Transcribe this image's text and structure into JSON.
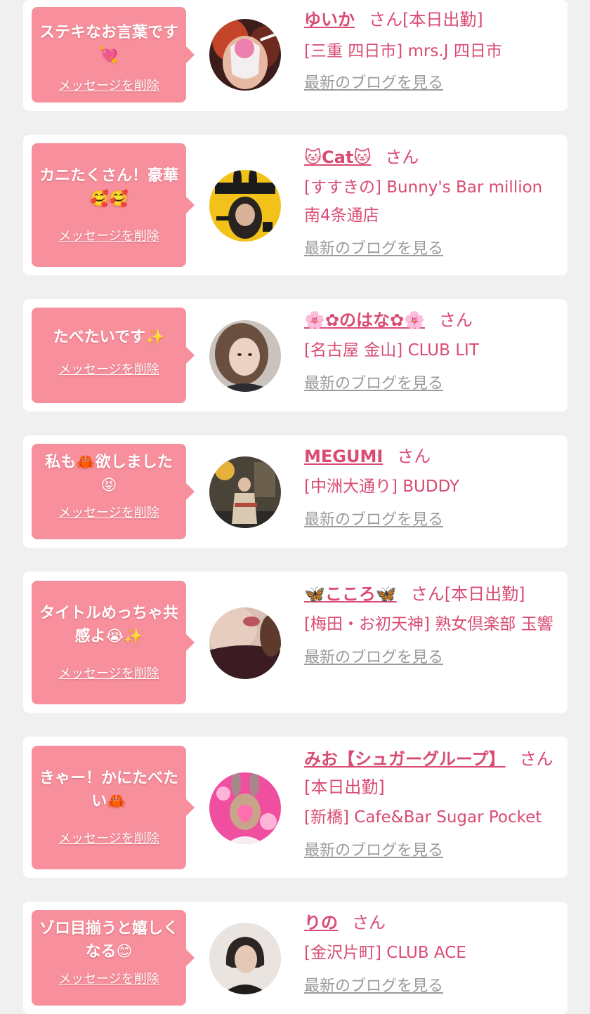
{
  "colors": {
    "page_bg": "#f0f0f0",
    "card_bg": "#ffffff",
    "bubble_bg": "#f7909c",
    "name_pink": "#d94b73",
    "link_gray": "#9a9a9a"
  },
  "common": {
    "delete_label": "メッセージを削除",
    "blog_label": "最新のブログを見る"
  },
  "items": [
    {
      "message": "ステキなお言葉です💘",
      "name": "ゆいか",
      "suffix": "さん[本日出勤]",
      "shop": "[三重 四日市] mrs.J 四日市",
      "avatar_icon": "masked-woman-photo"
    },
    {
      "message": "カニたくさん！豪華🥰🥰",
      "name": "🐱Cat🐱",
      "suffix": "さん",
      "shop": "[すすきの] Bunny's Bar million 南4条通店",
      "avatar_icon": "bunny-magazine-photo"
    },
    {
      "message": "たべたいです✨",
      "name": "🌸✿のはな✿🌸",
      "suffix": "さん",
      "shop": "[名古屋 金山] CLUB LIT",
      "avatar_icon": "woman-selfie-photo"
    },
    {
      "message": "私も🦀欲しました😝",
      "name": "MEGUMI",
      "suffix": "さん",
      "shop": "[中洲大通り] BUDDY",
      "avatar_icon": "kimono-woman-photo"
    },
    {
      "message": "タイトルめっちゃ共感よ😭✨",
      "name": "🦋こころ🦋",
      "suffix": "さん[本日出勤]",
      "shop": "[梅田・お初天神] 熟女倶楽部 玉響",
      "avatar_icon": "woman-portrait-photo"
    },
    {
      "message": "きゃー！かにたべたい🦀",
      "name": "みお【シュガーグループ】",
      "suffix": "さん[本日出勤]",
      "shop": "[新橋] Cafe&Bar Sugar Pocket",
      "avatar_icon": "bunny-ears-woman-photo"
    },
    {
      "message": "ゾロ目揃うと嬉しくなる😊",
      "name": "りの",
      "suffix": "さん",
      "shop": "[金沢片町] CLUB ACE",
      "avatar_icon": "short-hair-woman-photo"
    }
  ]
}
